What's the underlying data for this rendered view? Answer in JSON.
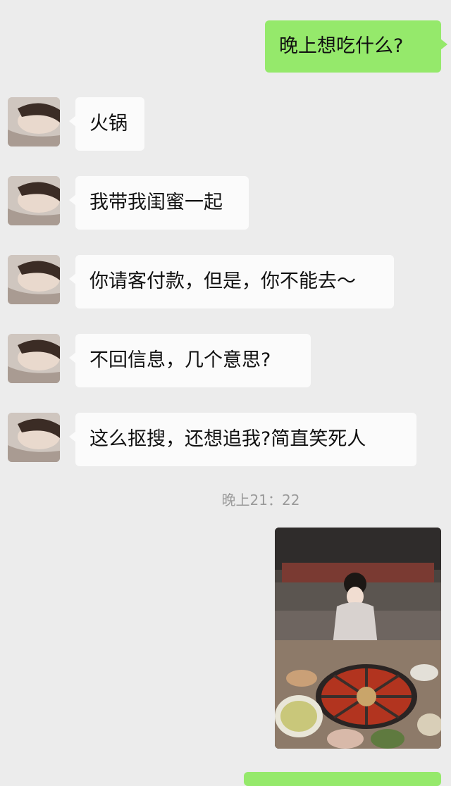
{
  "outgoing": [
    {
      "text": "晚上想吃什么?"
    }
  ],
  "incoming": [
    {
      "text": "火锅"
    },
    {
      "text": "我带我闺蜜一起"
    },
    {
      "text": "你请客付款，但是，你不能去～"
    },
    {
      "text": "不回信息，几个意思?"
    },
    {
      "text": "这么抠搜，还想追我?简直笑死人"
    }
  ],
  "timestamp": "晚上21：22",
  "colors": {
    "chat_background": "#ececec",
    "incoming_bubble": "#fbfbfb",
    "outgoing_bubble": "#95e96b",
    "timestamp_text": "#9a9a9a"
  },
  "icons": {
    "avatar": "contact-avatar-photo",
    "image_message": "hotpot-photo"
  }
}
